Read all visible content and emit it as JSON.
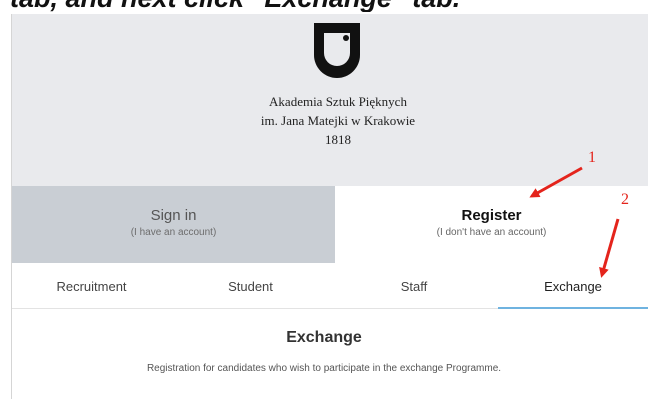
{
  "caption": {
    "text": "tab, and next click \"Exchange\" tab."
  },
  "header": {
    "logo_icon": "shield-u-logo-icon",
    "institution_line1": "Akademia Sztuk Pięknych",
    "institution_line2": "im. Jana Matejki w Krakowie",
    "year": "1818"
  },
  "auth": {
    "sign_in": {
      "title": "Sign in",
      "subtitle": "(I have an account)"
    },
    "register": {
      "title": "Register",
      "subtitle": "(I don't have an account)"
    }
  },
  "nav": {
    "tabs": [
      {
        "label": "Recruitment"
      },
      {
        "label": "Student"
      },
      {
        "label": "Staff"
      },
      {
        "label": "Exchange",
        "active": true
      }
    ]
  },
  "section": {
    "title": "Exchange",
    "description": "Registration for candidates who wish to participate in the exchange Programme."
  },
  "annotations": {
    "marker1": "1",
    "marker2": "2",
    "color": "#e4241c"
  },
  "colors": {
    "header_bg": "#e9eaed",
    "signin_bg": "#c9ced4",
    "active_underline": "#6fb3e0"
  }
}
